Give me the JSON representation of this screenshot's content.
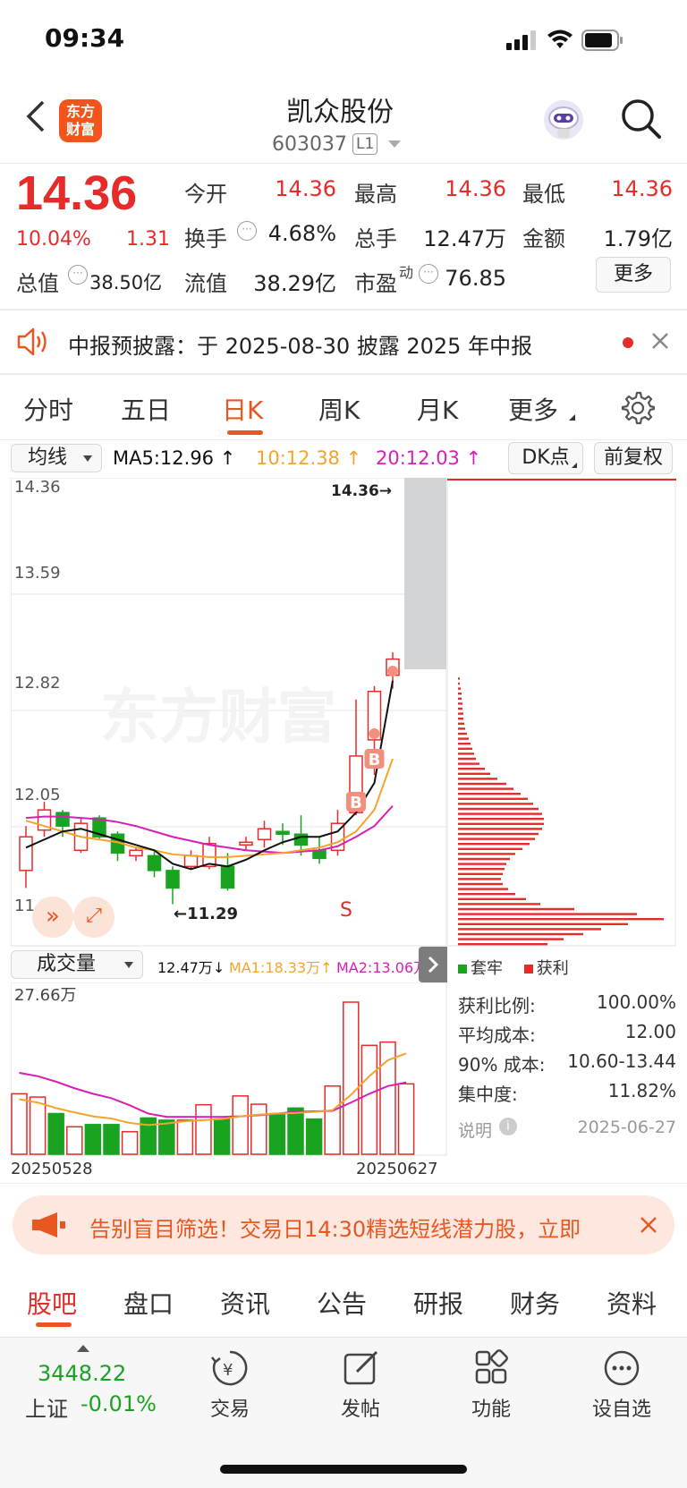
{
  "status_bar": {
    "time": "09:34"
  },
  "header": {
    "back_icon": "chevron-left-icon",
    "logo_text_top": "东方",
    "logo_text_bottom": "财富",
    "stock_name": "凯众股份",
    "stock_code": "603037",
    "level_badge": "L1",
    "robot_icon": "robot-avatar-icon",
    "search_icon": "search-icon"
  },
  "quote": {
    "price": "14.36",
    "change_pct": "10.04%",
    "change_amt": "1.31",
    "rows": [
      [
        {
          "label": "今开",
          "value": "14.36",
          "color": "#e62b2b"
        },
        {
          "label": "最高",
          "value": "14.36",
          "color": "#e62b2b"
        },
        {
          "label": "最低",
          "value": "14.36",
          "color": "#e62b2b"
        }
      ],
      [
        {
          "label": "换手",
          "value": "4.68%",
          "color": "#222222"
        },
        {
          "label": "总手",
          "value": "12.47万",
          "color": "#222222"
        },
        {
          "label": "金额",
          "value": "1.79亿",
          "color": "#222222"
        }
      ]
    ],
    "total_value_label": "总值",
    "total_value": "38.50亿",
    "float_value_label": "流值",
    "float_value": "38.29亿",
    "pe_label": "市盈",
    "pe_sup": "动",
    "pe_value": "76.85",
    "more_button": "更多"
  },
  "notice": {
    "text": "中报预披露：于 2025-08-30 披露 2025 年中报"
  },
  "chart_tabs": {
    "items": [
      "分时",
      "五日",
      "日K",
      "周K",
      "月K",
      "更多"
    ],
    "active_index": 2
  },
  "ma_bar": {
    "selector": "均线",
    "ma5": "MA5:12.96",
    "ma10": "10:12.38",
    "ma20": "20:12.03",
    "dk_button": "DK点",
    "adjust_button": "前复权"
  },
  "kline": {
    "y_labels": [
      "14.36",
      "13.59",
      "12.82",
      "12.05",
      "11.29"
    ],
    "high_mark": "14.36",
    "low_mark": "11.29",
    "watermark": "东方财富",
    "signal_s": "S",
    "signal_b": "B"
  },
  "volume_bar": {
    "selector": "成交量",
    "vol": "12.47万",
    "ma1": "MA1:18.33万",
    "ma2": "MA2:13.06万",
    "max_label": "27.66万",
    "date_start": "20250528",
    "date_end": "20250627"
  },
  "chip": {
    "legend_trapped": "套牢",
    "legend_profit": "获利",
    "rows": [
      {
        "label": "获利比例:",
        "value": "100.00%"
      },
      {
        "label": "平均成本:",
        "value": "12.00"
      },
      {
        "label": "90% 成本:",
        "value": "10.60-13.44"
      },
      {
        "label": "集中度:",
        "value": "11.82%"
      }
    ],
    "note_label": "说明",
    "note_date": "2025-06-27"
  },
  "ad_banner": {
    "text": "告别盲目筛选！交易日14:30精选短线潜力股，立即"
  },
  "bottom_tabs": {
    "items": [
      "股吧",
      "盘口",
      "资讯",
      "公告",
      "研报",
      "财务",
      "资料"
    ],
    "active_index": 0
  },
  "nav": {
    "index_value": "3448.22",
    "index_name": "上证",
    "index_change": "-0.01%",
    "items": [
      {
        "label": "交易",
        "icon": "yen-exchange-icon"
      },
      {
        "label": "发帖",
        "icon": "edit-post-icon"
      },
      {
        "label": "功能",
        "icon": "grid-apps-icon"
      },
      {
        "label": "设自选",
        "icon": "more-dots-icon"
      }
    ]
  },
  "candles": [
    {
      "o": 11.55,
      "c": 11.8,
      "h": 11.88,
      "l": 11.42
    },
    {
      "o": 11.85,
      "c": 12.0,
      "h": 12.06,
      "l": 11.8
    },
    {
      "o": 11.98,
      "c": 11.88,
      "h": 12.0,
      "l": 11.8
    },
    {
      "o": 11.7,
      "c": 11.9,
      "h": 11.94,
      "l": 11.68
    },
    {
      "o": 11.94,
      "c": 11.8,
      "h": 11.96,
      "l": 11.78
    },
    {
      "o": 11.82,
      "c": 11.68,
      "h": 11.84,
      "l": 11.62
    },
    {
      "o": 11.66,
      "c": 11.7,
      "h": 11.72,
      "l": 11.62
    },
    {
      "o": 11.66,
      "c": 11.55,
      "h": 11.7,
      "l": 11.5
    },
    {
      "o": 11.55,
      "c": 11.42,
      "h": 11.58,
      "l": 11.3
    },
    {
      "o": 11.58,
      "c": 11.66,
      "h": 11.7,
      "l": 11.56
    },
    {
      "o": 11.58,
      "c": 11.75,
      "h": 11.8,
      "l": 11.56
    },
    {
      "o": 11.58,
      "c": 11.42,
      "h": 11.68,
      "l": 11.4
    },
    {
      "o": 11.74,
      "c": 11.76,
      "h": 11.8,
      "l": 11.7
    },
    {
      "o": 11.78,
      "c": 11.86,
      "h": 11.92,
      "l": 11.72
    },
    {
      "o": 11.84,
      "c": 11.82,
      "h": 11.9,
      "l": 11.74
    },
    {
      "o": 11.82,
      "c": 11.74,
      "h": 11.96,
      "l": 11.66
    },
    {
      "o": 11.7,
      "c": 11.64,
      "h": 11.8,
      "l": 11.6
    },
    {
      "o": 11.7,
      "c": 11.9,
      "h": 12.0,
      "l": 11.66
    },
    {
      "o": 11.98,
      "c": 12.4,
      "h": 12.82,
      "l": 11.96
    },
    {
      "o": 12.52,
      "c": 12.88,
      "h": 12.92,
      "l": 12.26
    },
    {
      "o": 13.0,
      "c": 13.12,
      "h": 13.17,
      "l": 12.9
    }
  ],
  "ma5": [
    11.72,
    11.78,
    11.84,
    11.86,
    11.82,
    11.78,
    11.74,
    11.7,
    11.6,
    11.56,
    11.6,
    11.58,
    11.63,
    11.7,
    11.76,
    11.8,
    11.8,
    11.84,
    11.98,
    12.2,
    12.96
  ],
  "ma10": [
    11.92,
    11.88,
    11.84,
    11.8,
    11.78,
    11.76,
    11.72,
    11.7,
    11.67,
    11.66,
    11.65,
    11.65,
    11.66,
    11.67,
    11.68,
    11.7,
    11.72,
    11.76,
    11.84,
    12.0,
    12.38
  ],
  "ma20": [
    11.94,
    11.95,
    11.95,
    11.94,
    11.93,
    11.91,
    11.88,
    11.84,
    11.8,
    11.77,
    11.74,
    11.72,
    11.7,
    11.69,
    11.68,
    11.69,
    11.7,
    11.73,
    11.8,
    11.88,
    12.03
  ],
  "volumes": [
    {
      "v": 11.0,
      "up": true
    },
    {
      "v": 10.4,
      "up": true
    },
    {
      "v": 7.4,
      "up": false
    },
    {
      "v": 5.0,
      "up": true
    },
    {
      "v": 5.4,
      "up": false
    },
    {
      "v": 5.4,
      "up": false
    },
    {
      "v": 4.1,
      "up": true
    },
    {
      "v": 6.6,
      "up": false
    },
    {
      "v": 6.2,
      "up": false
    },
    {
      "v": 6.2,
      "up": true
    },
    {
      "v": 9.0,
      "up": true
    },
    {
      "v": 6.4,
      "up": false
    },
    {
      "v": 10.6,
      "up": true
    },
    {
      "v": 9.1,
      "up": true
    },
    {
      "v": 7.4,
      "up": false
    },
    {
      "v": 8.4,
      "up": false
    },
    {
      "v": 6.4,
      "up": false
    },
    {
      "v": 12.4,
      "up": true
    },
    {
      "v": 27.66,
      "up": true
    },
    {
      "v": 19.8,
      "up": true
    },
    {
      "v": 20.4,
      "up": true
    },
    {
      "v": 12.8,
      "up": true
    }
  ],
  "vol_ma1": [
    10.0,
    9.4,
    8.4,
    7.6,
    6.9,
    6.5,
    5.7,
    5.3,
    5.6,
    6.0,
    6.2,
    6.4,
    6.9,
    7.2,
    7.4,
    7.5,
    7.7,
    8.0,
    10.8,
    14.2,
    17.1,
    18.33
  ],
  "vol_ma2": [
    14.8,
    14.2,
    13.2,
    12.0,
    11.0,
    10.2,
    8.9,
    7.4,
    6.8,
    6.8,
    6.8,
    6.8,
    6.9,
    7.1,
    7.4,
    7.7,
    7.8,
    7.9,
    9.4,
    11.0,
    12.4,
    13.06
  ]
}
